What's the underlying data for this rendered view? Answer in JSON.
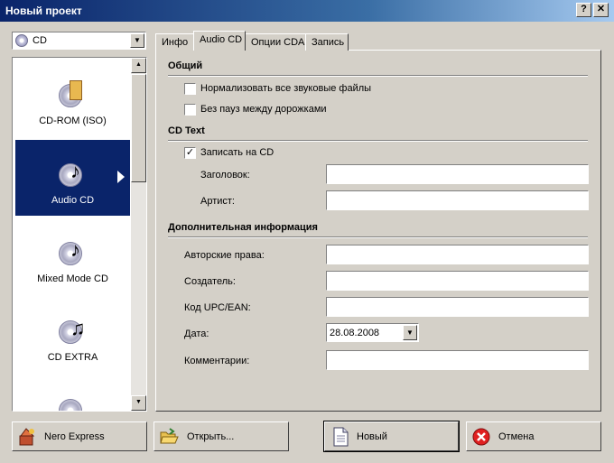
{
  "window": {
    "title": "Новый проект",
    "help_label": "?",
    "close_label": "✕"
  },
  "project_type_combo": {
    "value": "CD",
    "icon": "cd-disc-icon"
  },
  "project_types": [
    {
      "label": "CD-ROM (ISO)",
      "icon": "cdrom-iso-icon"
    },
    {
      "label": "Audio CD",
      "icon": "audio-cd-icon",
      "selected": true
    },
    {
      "label": "Mixed Mode CD",
      "icon": "mixed-mode-cd-icon"
    },
    {
      "label": "CD EXTRA",
      "icon": "cd-extra-icon"
    }
  ],
  "tabs": [
    {
      "label": "Инфо"
    },
    {
      "label": "Audio CD",
      "active": true
    },
    {
      "label": "Опции CDA"
    },
    {
      "label": "Запись"
    }
  ],
  "general": {
    "heading": "Общий",
    "normalize_label": "Нормализовать все звуковые файлы",
    "normalize_checked": false,
    "no_gaps_label": "Без пауз между дорожками",
    "no_gaps_checked": false
  },
  "cdtext": {
    "heading": "CD Text",
    "write_label": "Записать на CD",
    "write_checked": true,
    "title_label": "Заголовок:",
    "title_value": "",
    "artist_label": "Артист:",
    "artist_value": ""
  },
  "extra": {
    "heading": "Дополнительная информация",
    "copyright_label": "Авторские права:",
    "copyright_value": "",
    "creator_label": "Создатель:",
    "creator_value": "",
    "upc_label": "Код UPC/EAN:",
    "upc_value": "",
    "date_label": "Дата:",
    "date_value": "28.08.2008",
    "comments_label": "Комментарии:",
    "comments_value": ""
  },
  "buttons": {
    "nero_express": "Nero Express",
    "open": "Открыть...",
    "new": "Новый",
    "cancel": "Отмена"
  },
  "colors": {
    "selection": "#0a246a",
    "face": "#d4d0c8"
  }
}
